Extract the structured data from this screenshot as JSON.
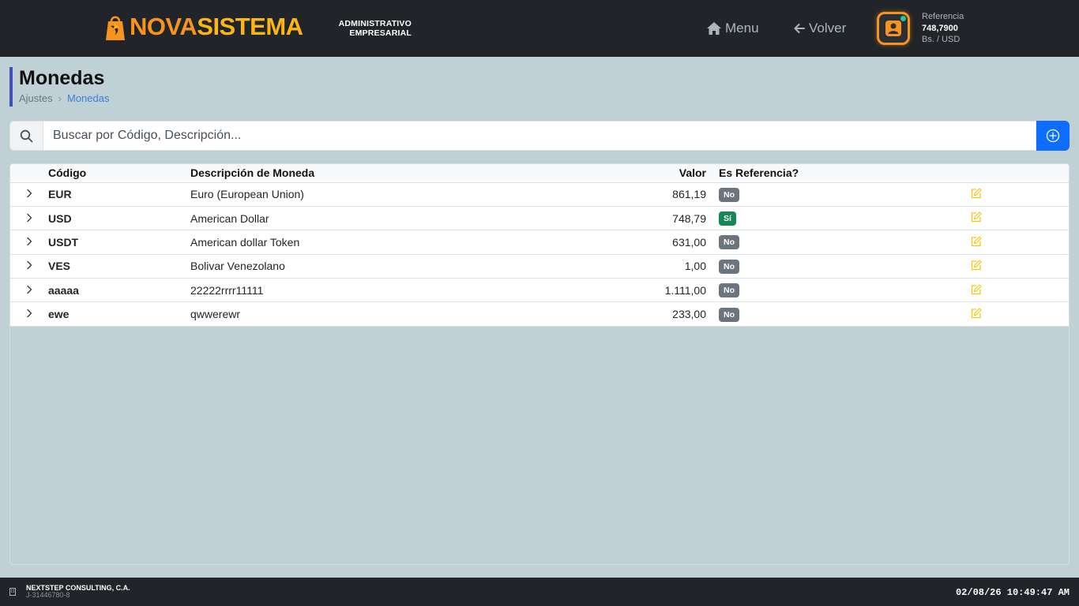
{
  "header": {
    "logo_part1": "NOVA",
    "logo_part2": "SISTEMA",
    "logo_subtitle_line1": "ADMINISTRATIVO",
    "logo_subtitle_line2": "EMPRESARIAL",
    "nav": {
      "menu_label": "Menu",
      "volver_label": "Volver"
    },
    "reference": {
      "label": "Referencia",
      "value": "748,7900",
      "unit": "Bs. / USD"
    },
    "colors": {
      "brand_orange": "#f7941d",
      "brand_yellow": "#fbb614",
      "status_dot": "#20c997"
    }
  },
  "page": {
    "title": "Monedas",
    "breadcrumb": [
      "Ajustes",
      "Monedas"
    ]
  },
  "search": {
    "placeholder": "Buscar por Código, Descripción...",
    "value": ""
  },
  "table": {
    "columns": [
      "Código",
      "Descripción de Moneda",
      "Valor",
      "Es Referencia?"
    ],
    "rows": [
      {
        "code": "EUR",
        "description": "Euro (European Union)",
        "value": "861,19",
        "is_reference": "No"
      },
      {
        "code": "USD",
        "description": "American Dollar",
        "value": "748,79",
        "is_reference": "Sí"
      },
      {
        "code": "USDT",
        "description": "American dollar Token",
        "value": "631,00",
        "is_reference": "No"
      },
      {
        "code": "VES",
        "description": "Bolivar Venezolano",
        "value": "1,00",
        "is_reference": "No"
      },
      {
        "code": "aaaaa",
        "description": "22222rrrr11111",
        "value": "1.111,00",
        "is_reference": "No"
      },
      {
        "code": "ewe",
        "description": "qwwerewr",
        "value": "233,00",
        "is_reference": "No"
      }
    ]
  },
  "footer": {
    "company_name": "NEXTSTEP CONSULTING, C.A.",
    "company_id": "J-31446780-8",
    "datetime": "02/08/26 10:49:47 AM"
  }
}
